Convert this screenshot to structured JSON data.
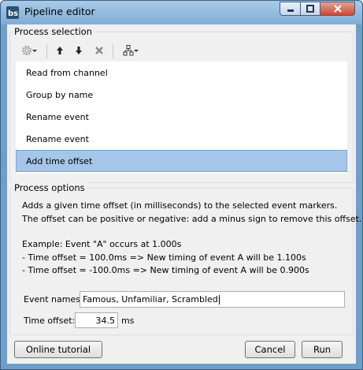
{
  "window": {
    "title": "Pipeline editor",
    "app_icon": "bs-logo-icon",
    "controls": [
      "minimize-icon",
      "maximize-icon",
      "close-icon"
    ]
  },
  "process_selection": {
    "label": "Process selection",
    "toolbar": {
      "icons": [
        "gear-icon",
        "chevron-down-icon",
        "arrow-up-icon",
        "arrow-down-icon",
        "delete-x-icon",
        "tree-icon",
        "chevron-down-icon"
      ]
    },
    "items": [
      {
        "label": "Read from channel"
      },
      {
        "label": "Group by name"
      },
      {
        "label": "Rename event"
      },
      {
        "label": "Rename event"
      },
      {
        "label": "Add time offset",
        "selected": true
      }
    ],
    "selection_color": "#a5c6e8"
  },
  "process_options": {
    "label": "Process options",
    "description": [
      "Adds a given time offset (in milliseconds) to the selected event markers.",
      "The offset can be positive or negative: add a minus sign to remove this offset.",
      "Example: Event \"A\" occurs at 1.000s",
      "- Time offset =  100.0ms => New timing of event A will be 1.100s",
      "- Time offset = -100.0ms => New timing of event A will be 0.900s"
    ],
    "event_names": {
      "label": "Event names:",
      "value": "Famous, Unfamiliar, Scrambled"
    },
    "time_offset": {
      "label": "Time offset:",
      "value": "34.5",
      "unit": "ms"
    }
  },
  "buttons": {
    "tutorial": "Online tutorial",
    "cancel": "Cancel",
    "run": "Run"
  }
}
